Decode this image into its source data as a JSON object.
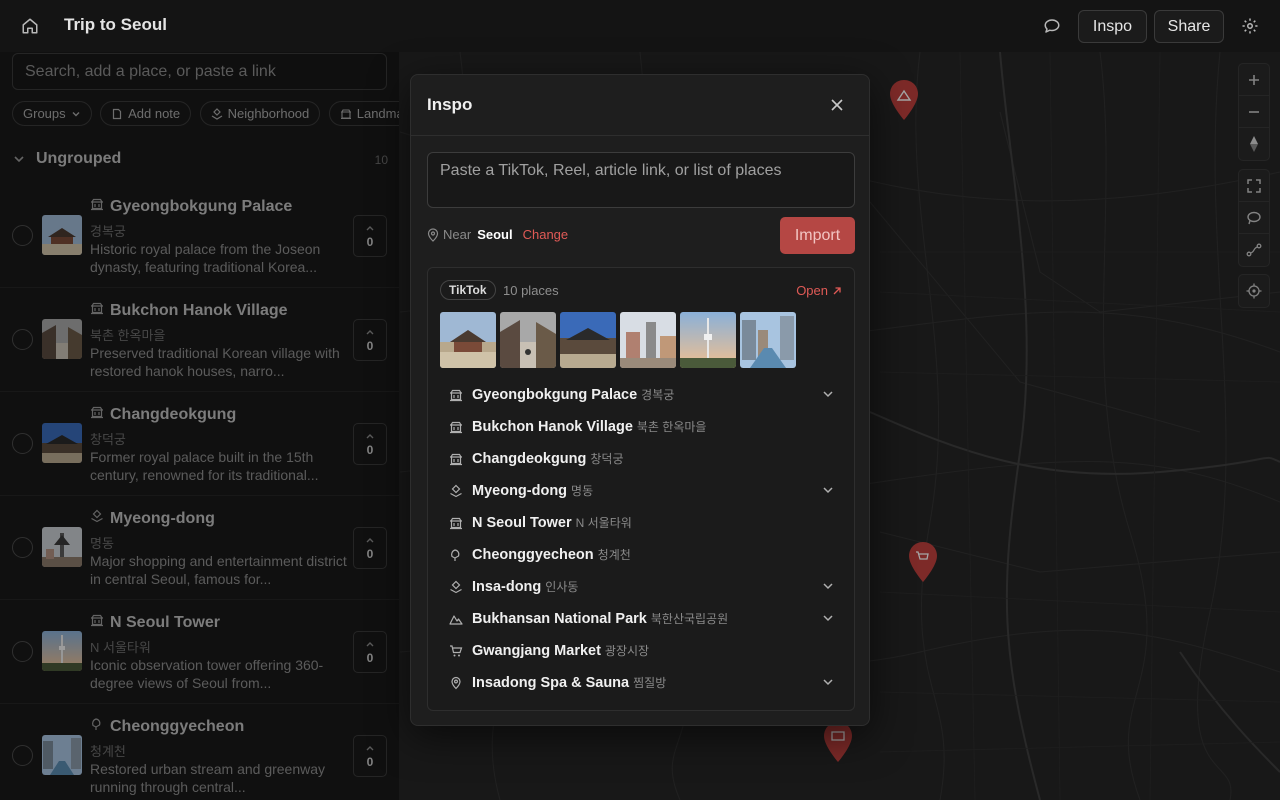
{
  "header": {
    "title": "Trip to Seoul",
    "inspo_label": "Inspo",
    "share_label": "Share"
  },
  "sidebar": {
    "search_placeholder": "Search, add a place, or paste a link",
    "chips": [
      "Groups",
      "Add note",
      "Neighborhood",
      "Landmark"
    ],
    "group": {
      "name": "Ungrouped",
      "count": "10"
    },
    "places": [
      {
        "title": "Gyeongbokgung Palace",
        "korean": "경복궁",
        "desc": "Historic royal palace from the Joseon dynasty, featuring traditional Korea...",
        "votes": "0",
        "icon": "landmark-icon"
      },
      {
        "title": "Bukchon Hanok Village",
        "korean": "북촌 한옥마을",
        "desc": "Preserved traditional Korean village with restored hanok houses, narro...",
        "votes": "0",
        "icon": "landmark-icon"
      },
      {
        "title": "Changdeokgung",
        "korean": "창덕궁",
        "desc": "Former royal palace built in the 15th century, renowned for its traditional...",
        "votes": "0",
        "icon": "landmark-icon"
      },
      {
        "title": "Myeong-dong",
        "korean": "명동",
        "desc": "Major shopping and entertainment district in central Seoul, famous for...",
        "votes": "0",
        "icon": "neighborhood-icon"
      },
      {
        "title": "N Seoul Tower",
        "korean": "N 서울타워",
        "desc": "Iconic observation tower offering 360-degree views of Seoul from...",
        "votes": "0",
        "icon": "landmark-icon"
      },
      {
        "title": "Cheonggyecheon",
        "korean": "청계천",
        "desc": "Restored urban stream and greenway running through central...",
        "votes": "0",
        "icon": "park-icon"
      }
    ]
  },
  "modal": {
    "title": "Inspo",
    "paste_placeholder": "Paste a TikTok, Reel, article link, or list of places",
    "near_label": "Near",
    "near_city": "Seoul",
    "change_label": "Change",
    "import_label": "Import",
    "source": {
      "badge": "TikTok",
      "count": "10 places",
      "open_label": "Open",
      "places": [
        {
          "name": "Gyeongbokgung Palace",
          "korean": "경복궁",
          "icon": "landmark-icon",
          "expandable": true
        },
        {
          "name": "Bukchon Hanok Village",
          "korean": "북촌 한옥마을",
          "icon": "landmark-icon",
          "expandable": false
        },
        {
          "name": "Changdeokgung",
          "korean": "창덕궁",
          "icon": "landmark-icon",
          "expandable": false
        },
        {
          "name": "Myeong-dong",
          "korean": "명동",
          "icon": "neighborhood-icon",
          "expandable": true
        },
        {
          "name": "N Seoul Tower",
          "korean": "N 서울타워",
          "icon": "landmark-icon",
          "expandable": false
        },
        {
          "name": "Cheonggyecheon",
          "korean": "청계천",
          "icon": "park-icon",
          "expandable": false
        },
        {
          "name": "Insa-dong",
          "korean": "인사동",
          "icon": "neighborhood-icon",
          "expandable": true
        },
        {
          "name": "Bukhansan National Park",
          "korean": "북한산국립공원",
          "icon": "mountain-icon",
          "expandable": true
        },
        {
          "name": "Gwangjang Market",
          "korean": "광장시장",
          "icon": "cart-icon",
          "expandable": false
        },
        {
          "name": "Insadong Spa & Sauna",
          "korean": "찜질방",
          "icon": "pin-icon",
          "expandable": true
        }
      ]
    }
  },
  "colors": {
    "accent": "#e05a56",
    "import_button": "#b54744",
    "map_marker": "#c0413e"
  }
}
